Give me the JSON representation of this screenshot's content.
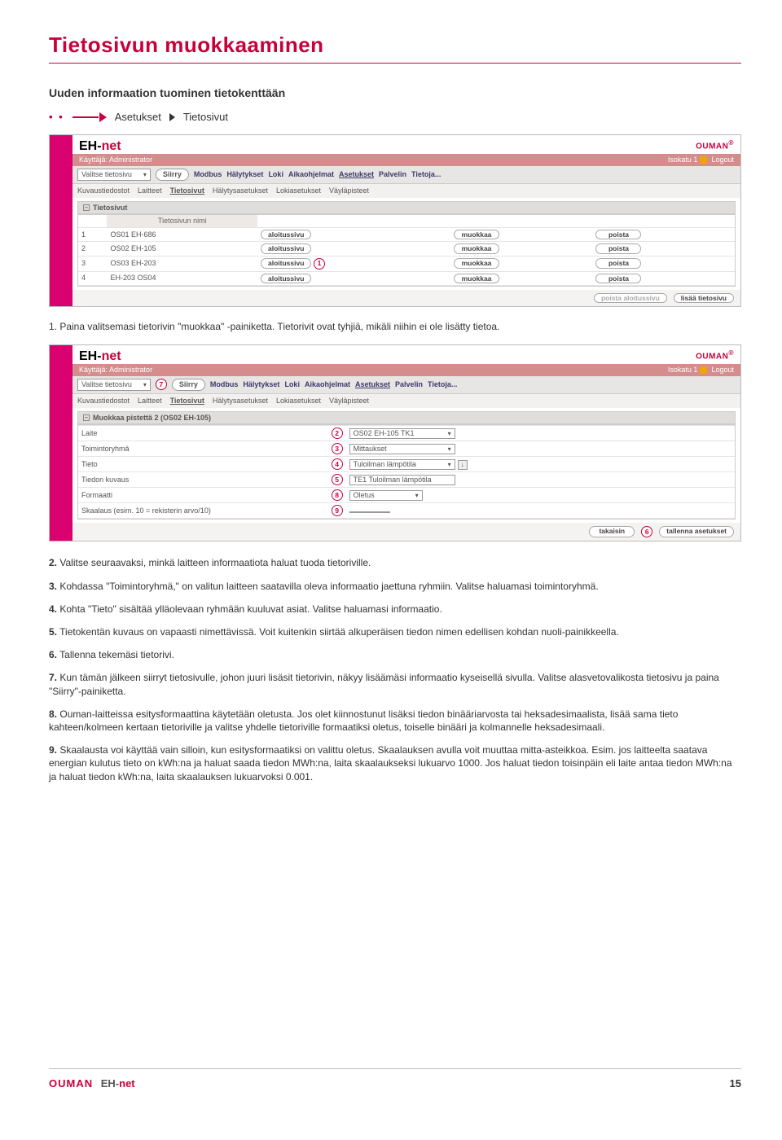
{
  "section_title": "Tietosivun muokkaaminen",
  "subheading": "Uuden informaation tuominen tietokenttään",
  "crumb1": "Asetukset",
  "crumb2": "Tietosivut",
  "brand_eh": "EH-",
  "brand_net": "net",
  "brand_ouman": "OUMAN",
  "user_label": "Käyttäjä:",
  "user_value": "Administrator",
  "loc_label": "Isokatu 1",
  "logout": "Logout",
  "menu": {
    "select_label": "Valitse tietosivu",
    "siirry": "Siirry",
    "items": [
      "Modbus",
      "Hälytykset",
      "Loki",
      "Aikaohjelmat",
      "Asetukset",
      "Palvelin",
      "Tietoja..."
    ],
    "active": "Asetukset"
  },
  "submenu": {
    "items": [
      "Kuvaustiedostot",
      "Laitteet",
      "Tietosivut",
      "Hälytysasetukset",
      "Lokiasetukset",
      "Väyläpisteet"
    ],
    "active": "Tietosivut"
  },
  "panel1": {
    "title": "Tietosivut",
    "col_header": "Tietosivun nimi",
    "rows": [
      {
        "idx": "1",
        "name": "OS01 EH-686"
      },
      {
        "idx": "2",
        "name": "OS02 EH-105"
      },
      {
        "idx": "3",
        "name": "OS03 EH-203"
      },
      {
        "idx": "4",
        "name": "EH-203 OS04"
      }
    ],
    "btn_aloitus": "aloitussivu",
    "btn_muokkaa": "muokkaa",
    "btn_poista": "poista",
    "btn_poista_aloitus": "poista aloitussivu",
    "btn_lisaa": "lisää tietosivu"
  },
  "para_after_shot1": "1. Paina valitsemasi tietorivin \"muokkaa\" -painiketta. Tietorivit ovat tyhjiä, mikäli niihin ei ole lisätty tietoa.",
  "panel2": {
    "title": "Muokkaa pistettä 2 (OS02 EH-105)",
    "rows": {
      "laite_label": "Laite",
      "laite_value": "OS02 EH-105 TK1",
      "toim_label": "Toimintoryhmä",
      "toim_value": "Mittaukset",
      "tieto_label": "Tieto",
      "tieto_value": "Tuloilman lämpötila",
      "kuvaus_label": "Tiedon kuvaus",
      "kuvaus_value": "TE1 Tuloilman lämpötila",
      "formaatti_label": "Formaatti",
      "formaatti_value": "Oletus",
      "skaala_label": "Skaalaus (esim. 10 = rekisterin arvo/10)",
      "skaala_value": ""
    },
    "btn_takaisin": "takaisin",
    "btn_tallenna": "tallenna asetukset"
  },
  "body_paragraphs": [
    {
      "num": "2.",
      "text": "Valitse seuraavaksi, minkä laitteen informaatiota haluat tuoda tietoriville."
    },
    {
      "num": "3.",
      "text": "Kohdassa \"Toimintoryhmä,\" on valitun laitteen saatavilla oleva informaatio jaettuna ryhmiin.  Valitse haluamasi toimintoryhmä."
    },
    {
      "num": "4.",
      "text": "Kohta \"Tieto\" sisältää ylläolevaan ryhmään kuuluvat asiat. Valitse haluamasi informaatio."
    },
    {
      "num": "5.",
      "text": "Tietokentän kuvaus on vapaasti nimettävissä. Voit kuitenkin siirtää alkuperäisen tiedon nimen edellisen kohdan nuoli-painikkeella."
    },
    {
      "num": "6.",
      "text": "Tallenna tekemäsi tietorivi."
    },
    {
      "num": "7.",
      "text": "Kun tämän jälkeen siirryt tietosivulle, johon juuri lisäsit tietorivin, näkyy lisäämäsi informaatio kyseisellä sivulla. Valitse alasvetovalikosta tietosivu ja paina \"Siirry\"-painiketta."
    },
    {
      "num": "8.",
      "text": "Ouman-laitteissa esitysformaattina käytetään oletusta. Jos olet kiinnostunut lisäksi tiedon binääriarvosta tai heksadesimaalista, lisää sama tieto kahteen/kolmeen kertaan tietoriville ja valitse yhdelle tietoriville formaatiksi oletus, toiselle binääri ja kolmannelle heksadesimaali."
    },
    {
      "num": "9.",
      "text": "Skaalausta voi käyttää vain silloin, kun esitysformaatiksi on valittu oletus. Skaalauksen avulla voit muuttaa mitta-asteikkoa. Esim. jos laitteelta saatava energian kulutus tieto on kWh:na ja haluat saada tiedon MWh:na, laita skaalaukseksi lukuarvo 1000. Jos haluat tiedon toisinpäin eli laite antaa tiedon MWh:na ja haluat tiedon kWh:na, laita skaalauksen lukuarvoksi 0.001."
    }
  ],
  "footer": {
    "ouman": "OUMAN",
    "eh": "EH-",
    "net": "net",
    "page": "15"
  },
  "callouts": {
    "c1": "1",
    "c2": "2",
    "c3": "3",
    "c4": "4",
    "c5": "5",
    "c6": "6",
    "c7": "7",
    "c8": "8",
    "c9": "9"
  }
}
